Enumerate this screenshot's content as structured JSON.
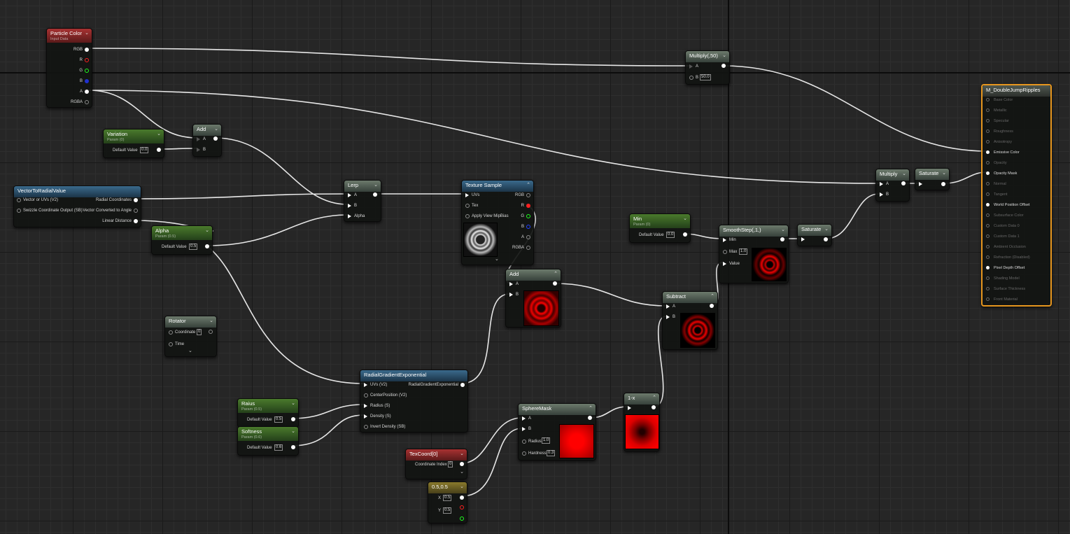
{
  "graph": {
    "material_node": {
      "title": "M_DoubleJumpRipples",
      "pins": [
        {
          "label": "Base Color",
          "active": false
        },
        {
          "label": "Metallic",
          "active": false
        },
        {
          "label": "Specular",
          "active": false
        },
        {
          "label": "Roughness",
          "active": false
        },
        {
          "label": "Anisotropy",
          "active": false
        },
        {
          "label": "Emissive Color",
          "active": true
        },
        {
          "label": "Opacity",
          "active": false
        },
        {
          "label": "Opacity Mask",
          "active": true
        },
        {
          "label": "Normal",
          "active": false
        },
        {
          "label": "Tangent",
          "active": false
        },
        {
          "label": "World Position Offset",
          "active": true
        },
        {
          "label": "Subsurface Color",
          "active": false
        },
        {
          "label": "Custom Data 0",
          "active": false
        },
        {
          "label": "Custom Data 1",
          "active": false
        },
        {
          "label": "Ambient Occlusion",
          "active": false
        },
        {
          "label": "Refraction (Disabled)",
          "active": false
        },
        {
          "label": "Pixel Depth Offset",
          "active": true
        },
        {
          "label": "Shading Model",
          "active": false
        },
        {
          "label": "Surface Thickness",
          "active": false
        },
        {
          "label": "Front Material",
          "active": false
        }
      ]
    },
    "particle_color": {
      "title": "Particle Color",
      "subtitle": "Input Data",
      "outputs": [
        "RGB",
        "R",
        "G",
        "B",
        "A",
        "RGBA"
      ]
    },
    "variation": {
      "title": "Variation",
      "subtitle": "Param (0)",
      "default_label": "Default Value",
      "default_value": "0.0"
    },
    "add1": {
      "title": "Add",
      "inputs": [
        "A",
        "B"
      ]
    },
    "vector_to_radial": {
      "title": "VectorToRadialValue",
      "inputs": [
        "Vector or UVs (V2)",
        "Swizzle Coordinate Output (SB)"
      ],
      "outputs": [
        "Radial Coordinates",
        "Vector Converted to Angle",
        "Linear Distance"
      ]
    },
    "alpha": {
      "title": "Alpha",
      "subtitle": "Param (0.5)",
      "default_label": "Default Value",
      "default_value": "0.5"
    },
    "lerp": {
      "title": "Lerp",
      "inputs": [
        "A",
        "B",
        "Alpha"
      ]
    },
    "texture_sample": {
      "title": "Texture Sample",
      "inputs": [
        "UVs",
        "Tex",
        "Apply View MipBias"
      ],
      "outputs": [
        "RGB",
        "R",
        "G",
        "B",
        "A",
        "RGBA"
      ]
    },
    "multiply50": {
      "title": "Multiply(,50)",
      "inputs": [
        "A",
        "B"
      ],
      "b_value": "50.0"
    },
    "min": {
      "title": "Min",
      "subtitle": "Param (0)",
      "default_label": "Default Value",
      "default_value": "0.0"
    },
    "smoothstep": {
      "title": "SmoothStep(,1,)",
      "inputs": [
        "Min",
        "Max",
        "Value"
      ],
      "max_value": "1.0"
    },
    "saturate1": {
      "title": "Saturate"
    },
    "multiply2": {
      "title": "Multiply",
      "inputs": [
        "A",
        "B"
      ]
    },
    "saturate2": {
      "title": "Saturate"
    },
    "add2": {
      "title": "Add",
      "inputs": [
        "A",
        "B"
      ]
    },
    "subtract": {
      "title": "Subtract",
      "inputs": [
        "A",
        "B"
      ]
    },
    "rotator": {
      "title": "Rotator",
      "inputs": [
        "Coordinate",
        "Time"
      ],
      "coordinate_value": "0"
    },
    "radial_gradient": {
      "title": "RadialGradientExponential",
      "inputs": [
        "UVs (V2)",
        "CenterPosition (V2)",
        "Radius (S)",
        "Density (S)",
        "Invert Density (SB)"
      ],
      "output": "RadialGradientExponential"
    },
    "raius": {
      "title": "Raius",
      "subtitle": "Param (0.5)",
      "default_label": "Default Value",
      "default_value": "0.5"
    },
    "softness": {
      "title": "Softness",
      "subtitle": "Param (0.6)",
      "default_label": "Default Value",
      "default_value": "0.6"
    },
    "sphere_mask": {
      "title": "SphereMask",
      "inputs": [
        "A",
        "B",
        "Radius",
        "Hardness"
      ],
      "radius_value": "1.0",
      "hardness_value": "0.3"
    },
    "one_minus_x": {
      "title": "1-x"
    },
    "texcoord": {
      "title": "TexCoord[0]",
      "label": "Coordinate Index",
      "value": "0"
    },
    "const2": {
      "title": "0.5,0.5",
      "x_label": "X",
      "x_value": "0.5",
      "y_label": "Y",
      "y_value": "0.5"
    }
  },
  "colors": {
    "wire": "#e6e6e6",
    "material_border": "#e6961e",
    "background": "#262626"
  }
}
